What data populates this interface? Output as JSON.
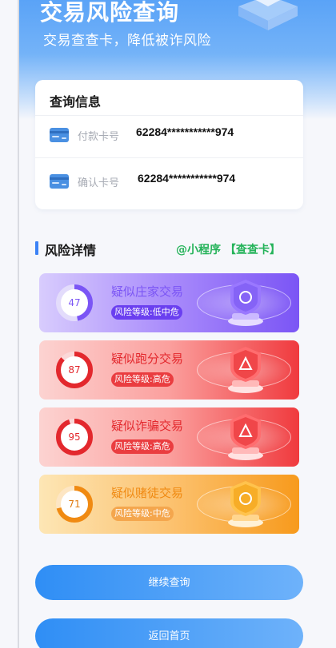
{
  "header": {
    "title": "交易风险查询",
    "subtitle": "交易查查卡，降低被诈风险"
  },
  "query": {
    "title": "查询信息",
    "rows": [
      {
        "label": "付款卡号",
        "value": "62284***********974",
        "icon": "bank-card-icon"
      },
      {
        "label": "确认卡号",
        "value": "62284***********974",
        "icon": "bank-card-icon"
      }
    ]
  },
  "risk": {
    "title": "风险详情",
    "mini_program": "@小程序 【查查卡】",
    "items": [
      {
        "name": "疑似庄家交易",
        "score": "47",
        "level": "风险等级:低中危",
        "score_fraction": 0.47
      },
      {
        "name": "疑似跑分交易",
        "score": "87",
        "level": "风险等级:高危",
        "score_fraction": 0.87
      },
      {
        "name": "疑似诈骗交易",
        "score": "95",
        "level": "风险等级:高危",
        "score_fraction": 0.95
      },
      {
        "name": "疑似赌徒交易",
        "score": "71",
        "level": "风险等级:中危",
        "score_fraction": 0.71
      }
    ]
  },
  "buttons": {
    "continue": "继续查询",
    "home": "返回首页"
  },
  "colors": {
    "accent_blue": "#3b82f6",
    "mini_program_green": "#25b35a",
    "purple": "#7b55f5",
    "red": "#f03a3e",
    "orange": "#f59a1b"
  }
}
